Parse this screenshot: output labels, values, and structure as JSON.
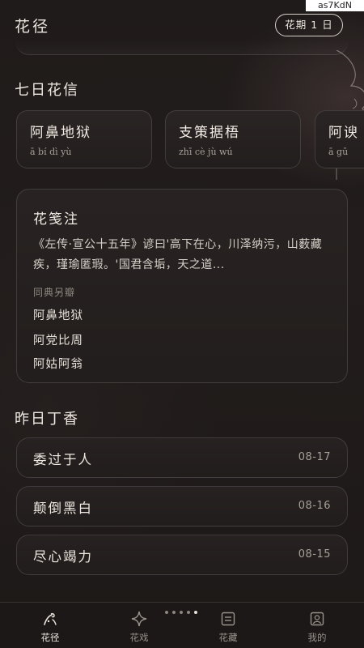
{
  "watermark": "as7KdN",
  "header": {
    "title": "花径",
    "period_badge": "花期 1 日"
  },
  "seven_day": {
    "section_title": "七日花信",
    "cards": [
      {
        "title": "阿鼻地狱",
        "pinyin": "ā bí dì yù"
      },
      {
        "title": "支策据梧",
        "pinyin": "zhī cè jù wú"
      },
      {
        "title": "阿谀",
        "pinyin": "ā gū"
      }
    ]
  },
  "note": {
    "title": "花笺注",
    "body": "《左传·宣公十五年》谚曰'高下在心，川泽纳污，山薮藏疾，瑾瑜匿瑕。'国君含垢，天之道...",
    "related_label": "同典另瓣",
    "related": [
      "阿鼻地狱",
      "阿党比周",
      "阿姑阿翁"
    ]
  },
  "history": {
    "section_title": "昨日丁香",
    "items": [
      {
        "word": "委过于人",
        "date": "08-17"
      },
      {
        "word": "颠倒黑白",
        "date": "08-16"
      },
      {
        "word": "尽心竭力",
        "date": "08-15"
      }
    ]
  },
  "pager": {
    "count": 5,
    "active_index": 4
  },
  "tabbar": {
    "active": 0,
    "tabs": [
      {
        "label": "花径",
        "icon": "flower-path-icon"
      },
      {
        "label": "花戏",
        "icon": "sparkle-icon"
      },
      {
        "label": "花藏",
        "icon": "list-box-icon"
      },
      {
        "label": "我的",
        "icon": "profile-icon"
      }
    ]
  },
  "colors": {
    "background": "#1e1a19",
    "text": "#ece6df",
    "muted": "#a69f98"
  }
}
